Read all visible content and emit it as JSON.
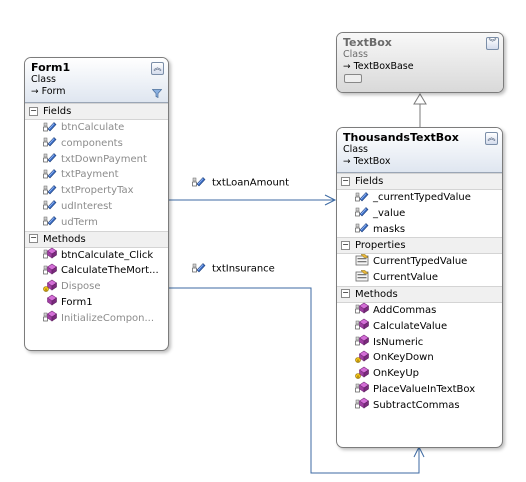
{
  "colors": {
    "connector": "#3c6aa3",
    "inheritance": "#7a7a7a",
    "field_icon": "#3d6fc4",
    "method_icon": "#b24bb5"
  },
  "classes": {
    "form1": {
      "name": "Form1",
      "stereotype": "Class",
      "base": "Form",
      "toggle_icon": "collapse-chevron-icon",
      "sections": {
        "fields": {
          "label": "Fields",
          "items": [
            "btnCalculate",
            "components",
            "txtDownPayment",
            "txtPayment",
            "txtPropertyTax",
            "udInterest",
            "udTerm"
          ]
        },
        "methods": {
          "label": "Methods",
          "items": [
            "btnCalculate_Click",
            "CalculateTheMort...",
            "Dispose",
            "Form1",
            "InitializeCompon..."
          ]
        }
      }
    },
    "textbox": {
      "name": "TextBox",
      "stereotype": "Class",
      "base": "TextBoxBase",
      "toggle_icon": "expand-chevron-icon"
    },
    "thousands": {
      "name": "ThousandsTextBox",
      "stereotype": "Class",
      "base": "TextBox",
      "toggle_icon": "collapse-chevron-icon",
      "sections": {
        "fields": {
          "label": "Fields",
          "items": [
            "_currentTypedValue",
            "_value",
            "masks"
          ]
        },
        "properties": {
          "label": "Properties",
          "items": [
            "CurrentTypedValue",
            "CurrentValue"
          ]
        },
        "methods": {
          "label": "Methods",
          "items": [
            "AddCommas",
            "CalculateValue",
            "IsNumeric",
            "OnKeyDown",
            "OnKeyUp",
            "PlaceValueInTextBox",
            "SubtractCommas"
          ]
        }
      }
    }
  },
  "associations": {
    "loan": "txtLoanAmount",
    "insurance": "txtInsurance"
  }
}
